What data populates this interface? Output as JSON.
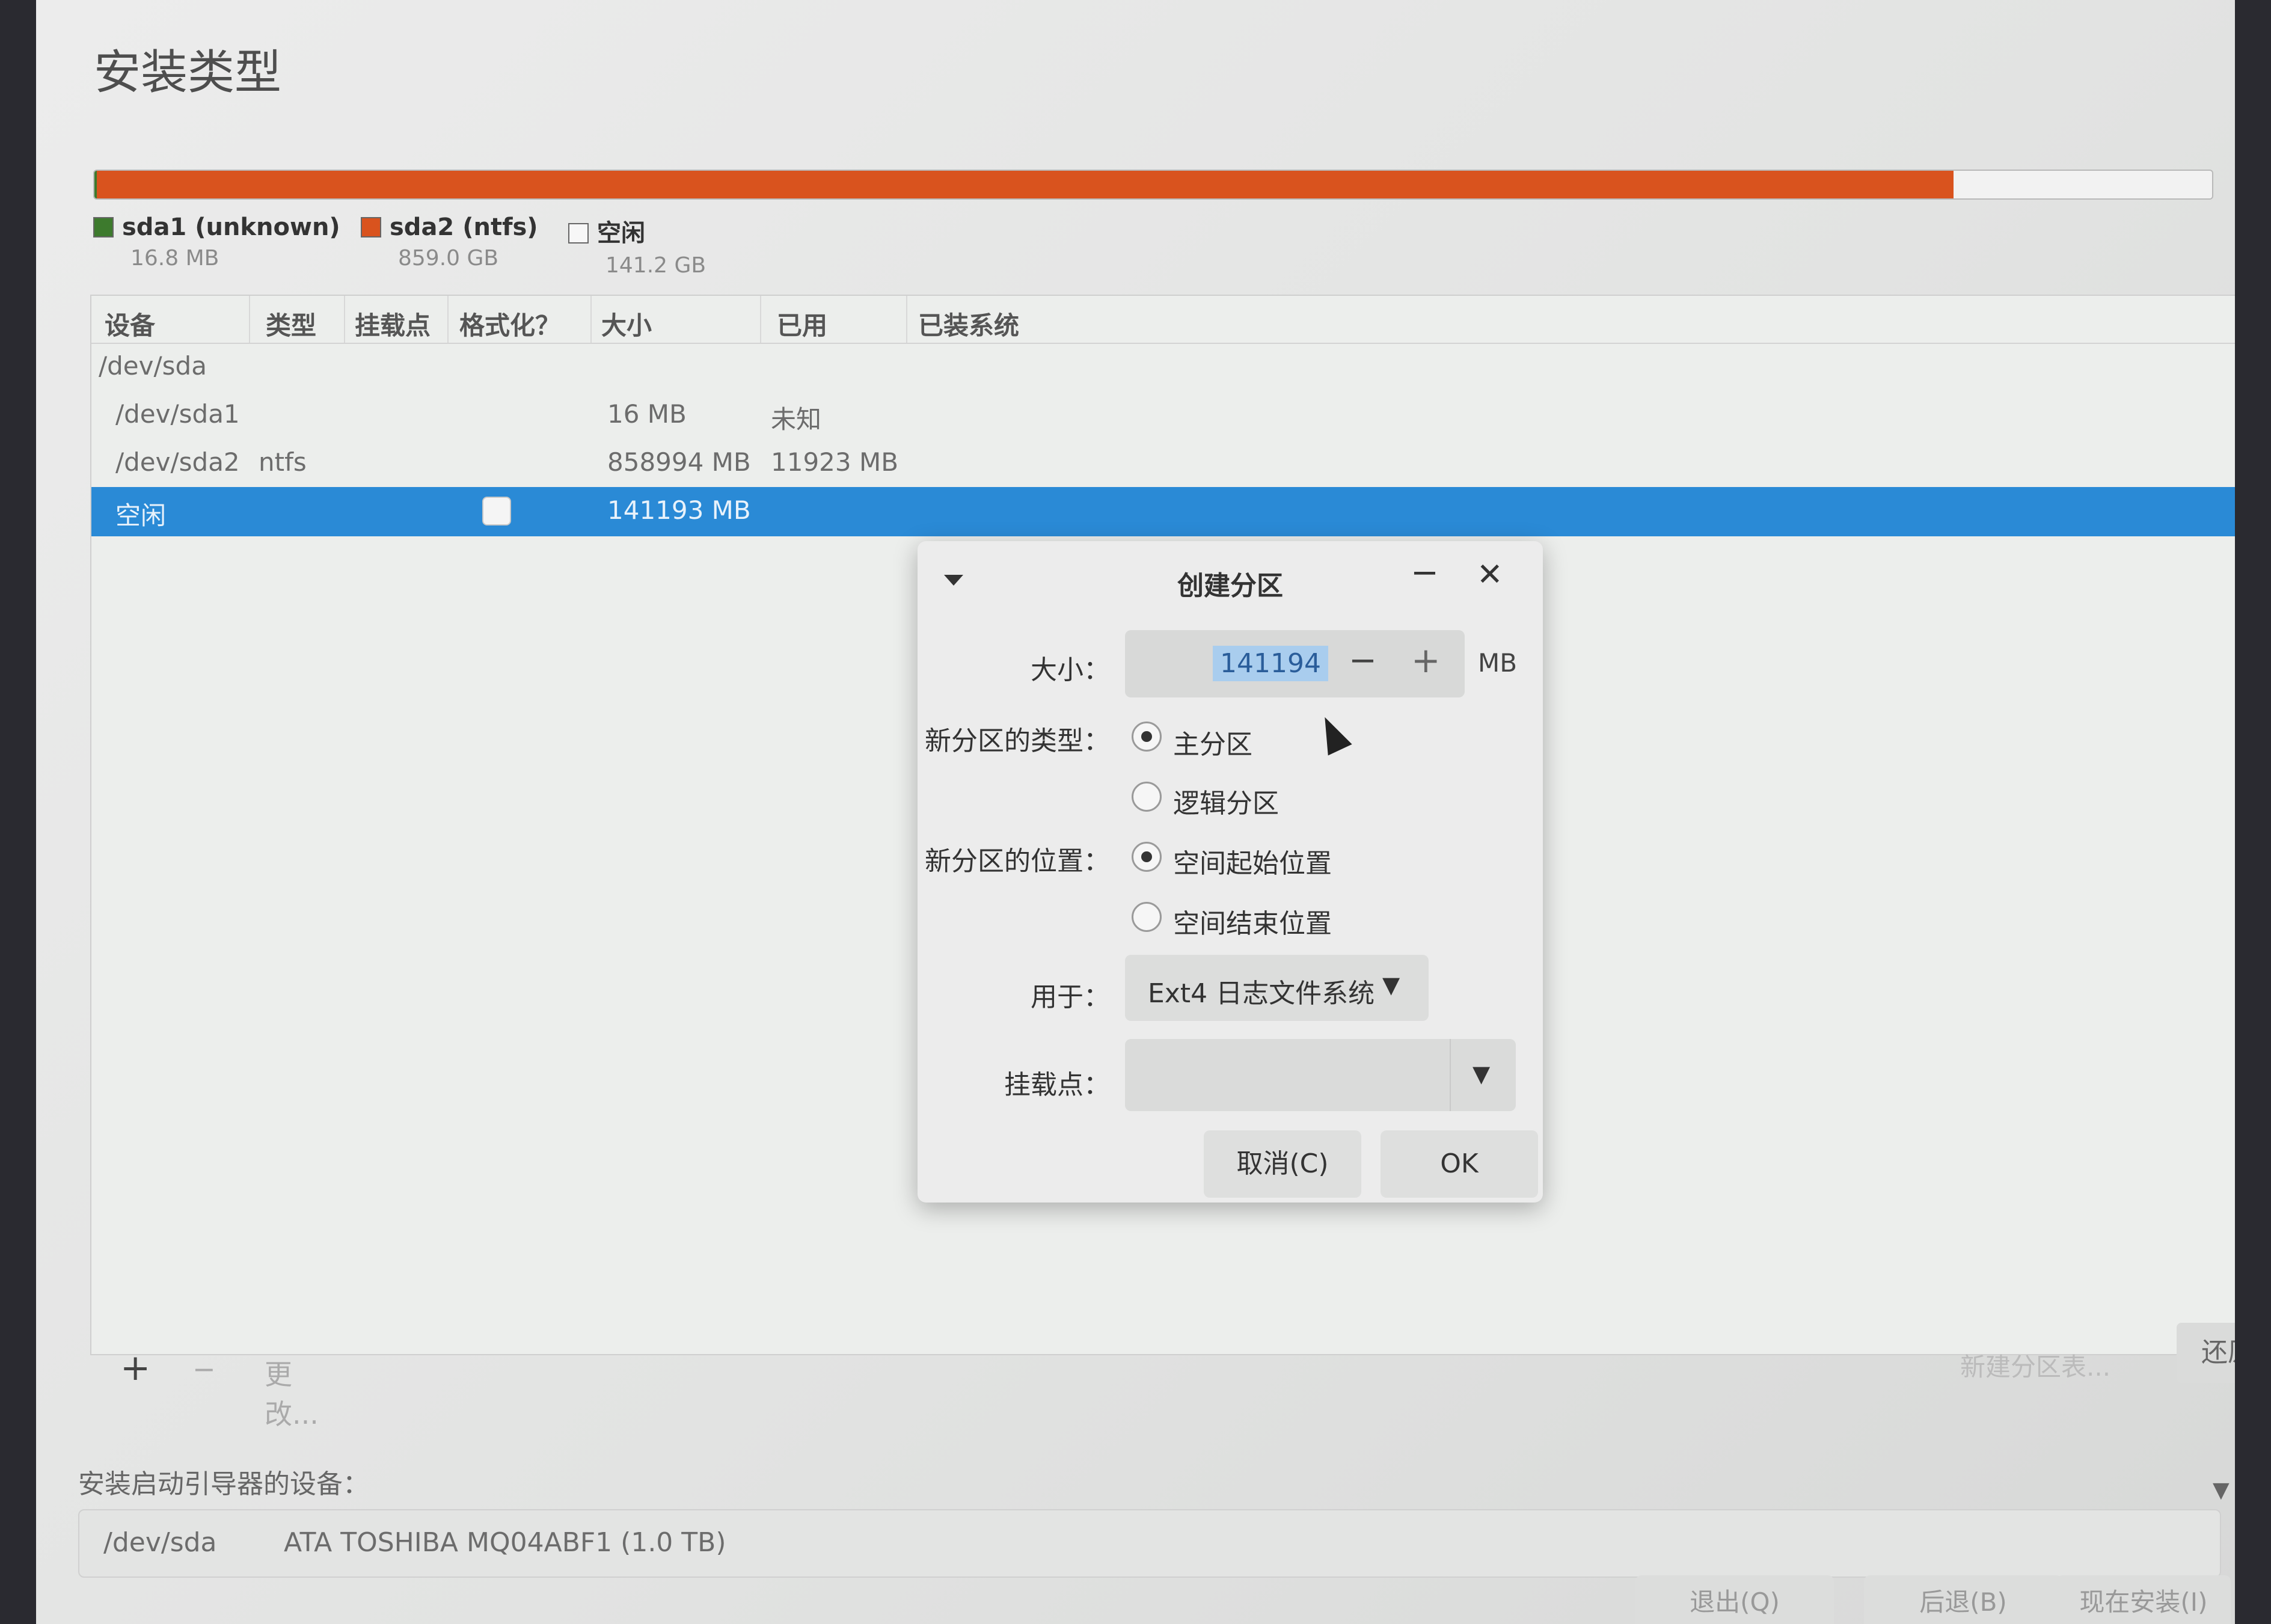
{
  "page": {
    "title": "安装类型"
  },
  "disk": {
    "segments": [
      {
        "id": "sda1",
        "name": "sda1 (unknown)",
        "size": "16.8 MB",
        "color": "#3d7a2d"
      },
      {
        "id": "sda2",
        "name": "sda2 (ntfs)",
        "size": "859.0 GB",
        "color": "#d9531e"
      },
      {
        "id": "free",
        "name": "空闲",
        "size": "141.2 GB",
        "color": "#f2f2f2"
      }
    ]
  },
  "table": {
    "headers": [
      "设备",
      "类型",
      "挂载点",
      "格式化？",
      "大小",
      "已用",
      "已装系统"
    ],
    "rows": [
      {
        "device": "/dev/sda",
        "type": "",
        "mount": "",
        "size": "",
        "used": ""
      },
      {
        "device": "/dev/sda1",
        "type": "",
        "mount": "",
        "size": "16 MB",
        "used": "未知"
      },
      {
        "device": "/dev/sda2",
        "type": "ntfs",
        "mount": "",
        "size": "858994 MB",
        "used": "11923 MB"
      },
      {
        "device": "空闲",
        "type": "",
        "mount": "",
        "size": "141193 MB",
        "used": "",
        "selected": true,
        "format_checked": false
      }
    ]
  },
  "tools": {
    "add": "+",
    "remove": "−",
    "change": "更改..."
  },
  "side": {
    "new_table": "新建分区表...",
    "restore": "还原"
  },
  "bootloader": {
    "label": "安装启动引导器的设备：",
    "device": "/dev/sda",
    "description": "ATA TOSHIBA MQ04ABF1 (1.0 TB)"
  },
  "footer": {
    "quit": "退出(Q)",
    "back": "后退(B)",
    "install": "现在安装(I)"
  },
  "dialog": {
    "title": "创建分区",
    "size_label": "大小：",
    "size_value": "141194",
    "size_unit": "MB",
    "type_label": "新分区的类型：",
    "type_primary": "主分区",
    "type_logical": "逻辑分区",
    "type_selected": "primary",
    "location_label": "新分区的位置：",
    "location_start": "空间起始位置",
    "location_end": "空间结束位置",
    "location_selected": "start",
    "use_label": "用于：",
    "use_value": "Ext4 日志文件系统",
    "mount_label": "挂载点：",
    "mount_value": "",
    "cancel": "取消(C)",
    "ok": "OK"
  }
}
